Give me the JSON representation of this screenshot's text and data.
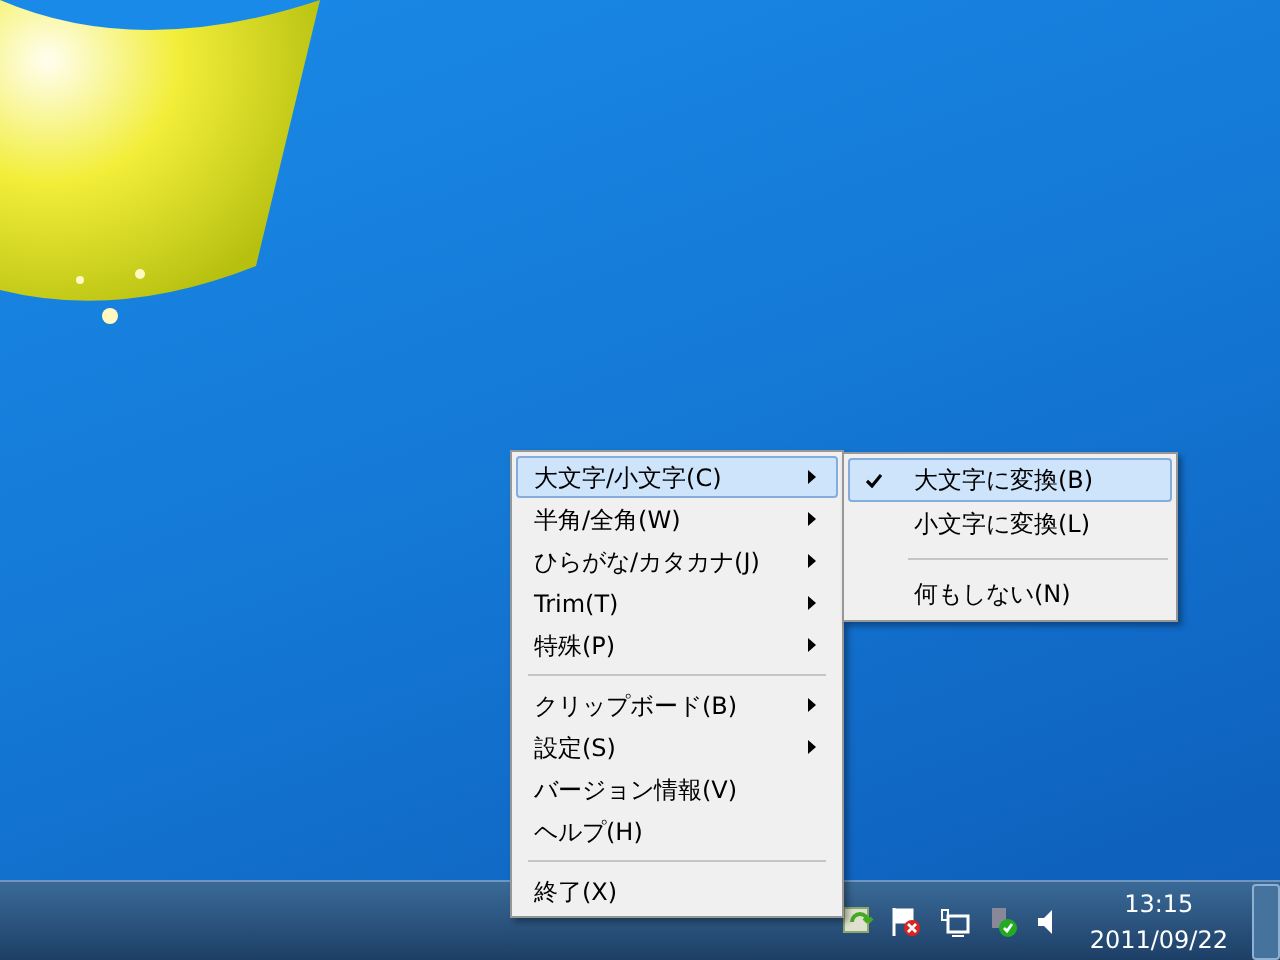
{
  "menu": {
    "items": [
      {
        "kind": "item",
        "label": "大文字/小文字(C)",
        "has_submenu": true,
        "selected": true
      },
      {
        "kind": "item",
        "label": "半角/全角(W)",
        "has_submenu": true,
        "selected": false
      },
      {
        "kind": "item",
        "label": "ひらがな/カタカナ(J)",
        "has_submenu": true,
        "selected": false
      },
      {
        "kind": "item",
        "label": "Trim(T)",
        "has_submenu": true,
        "selected": false
      },
      {
        "kind": "item",
        "label": "特殊(P)",
        "has_submenu": true,
        "selected": false
      },
      {
        "kind": "separator"
      },
      {
        "kind": "item",
        "label": "クリップボード(B)",
        "has_submenu": true,
        "selected": false
      },
      {
        "kind": "item",
        "label": "設定(S)",
        "has_submenu": true,
        "selected": false
      },
      {
        "kind": "item",
        "label": "バージョン情報(V)",
        "has_submenu": false,
        "selected": false
      },
      {
        "kind": "item",
        "label": "ヘルプ(H)",
        "has_submenu": false,
        "selected": false
      },
      {
        "kind": "separator"
      },
      {
        "kind": "item",
        "label": "終了(X)",
        "has_submenu": false,
        "selected": false
      }
    ]
  },
  "submenu": {
    "items": [
      {
        "kind": "item",
        "label": "大文字に変換(B)",
        "checked": true,
        "selected": true
      },
      {
        "kind": "item",
        "label": "小文字に変換(L)",
        "checked": false,
        "selected": false
      },
      {
        "kind": "separator"
      },
      {
        "kind": "item",
        "label": "何もしない(N)",
        "checked": false,
        "selected": false
      }
    ]
  },
  "taskbar": {
    "clock": {
      "time": "13:15",
      "date": "2011/09/22"
    }
  }
}
